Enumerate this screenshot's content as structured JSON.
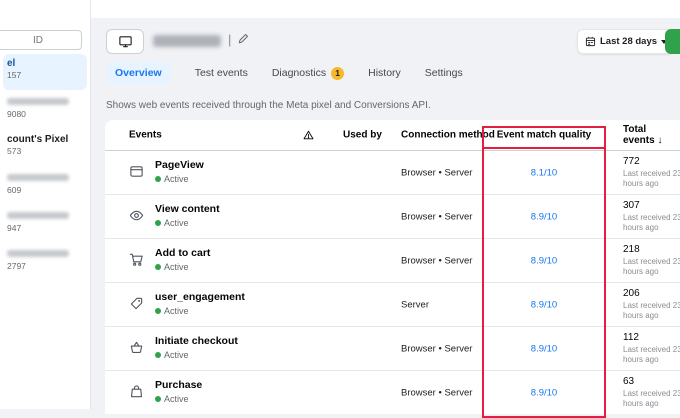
{
  "sidebar": {
    "search_placeholder": "ID",
    "items": [
      {
        "name": "el",
        "id": "157",
        "selected": true
      },
      {
        "name": "",
        "id": "9080",
        "selected": false
      },
      {
        "name": "count's Pixel",
        "id": "573",
        "selected": false
      },
      {
        "name": "",
        "id": "609",
        "selected": false
      },
      {
        "name": "",
        "id": "947",
        "selected": false
      },
      {
        "name": "",
        "id": "2797",
        "selected": false
      }
    ]
  },
  "topbar": {
    "separator": "|",
    "date_range_label": "Last 28 days"
  },
  "tabs": [
    {
      "label": "Overview",
      "active": true
    },
    {
      "label": "Test events",
      "active": false
    },
    {
      "label": "Diagnostics",
      "active": false,
      "badge": "1"
    },
    {
      "label": "History",
      "active": false
    },
    {
      "label": "Settings",
      "active": false
    }
  ],
  "main": {
    "description": "Shows web events received through the Meta pixel and Conversions API."
  },
  "table": {
    "headers": {
      "events": "Events",
      "used_by": "Used by",
      "connection_method": "Connection method",
      "event_match_quality": "Event match quality",
      "total_events": "Total events ↓"
    },
    "rows": [
      {
        "event": "PageView",
        "status": "Active",
        "connection": "Browser • Server",
        "quality": "8.1/10",
        "total": "772",
        "last_received": "Last received 23 hours ago"
      },
      {
        "event": "View content",
        "status": "Active",
        "connection": "Browser • Server",
        "quality": "8.9/10",
        "total": "307",
        "last_received": "Last received 23 hours ago"
      },
      {
        "event": "Add to cart",
        "status": "Active",
        "connection": "Browser • Server",
        "quality": "8.9/10",
        "total": "218",
        "last_received": "Last received 23 hours ago"
      },
      {
        "event": "user_engagement",
        "status": "Active",
        "connection": "Server",
        "quality": "8.9/10",
        "total": "206",
        "last_received": "Last received 23 hours ago"
      },
      {
        "event": "Initiate checkout",
        "status": "Active",
        "connection": "Browser • Server",
        "quality": "8.9/10",
        "total": "112",
        "last_received": "Last received 23 hours ago"
      },
      {
        "event": "Purchase",
        "status": "Active",
        "connection": "Browser • Server",
        "quality": "8.9/10",
        "total": "63",
        "last_received": "Last received 23 hours ago"
      }
    ]
  },
  "colors": {
    "accent_blue": "#1877f2",
    "annotation_red": "#e41e3f",
    "status_green": "#31a24c",
    "badge_yellow": "#f7b928",
    "selected_item_bg": "#e7f3ff"
  }
}
